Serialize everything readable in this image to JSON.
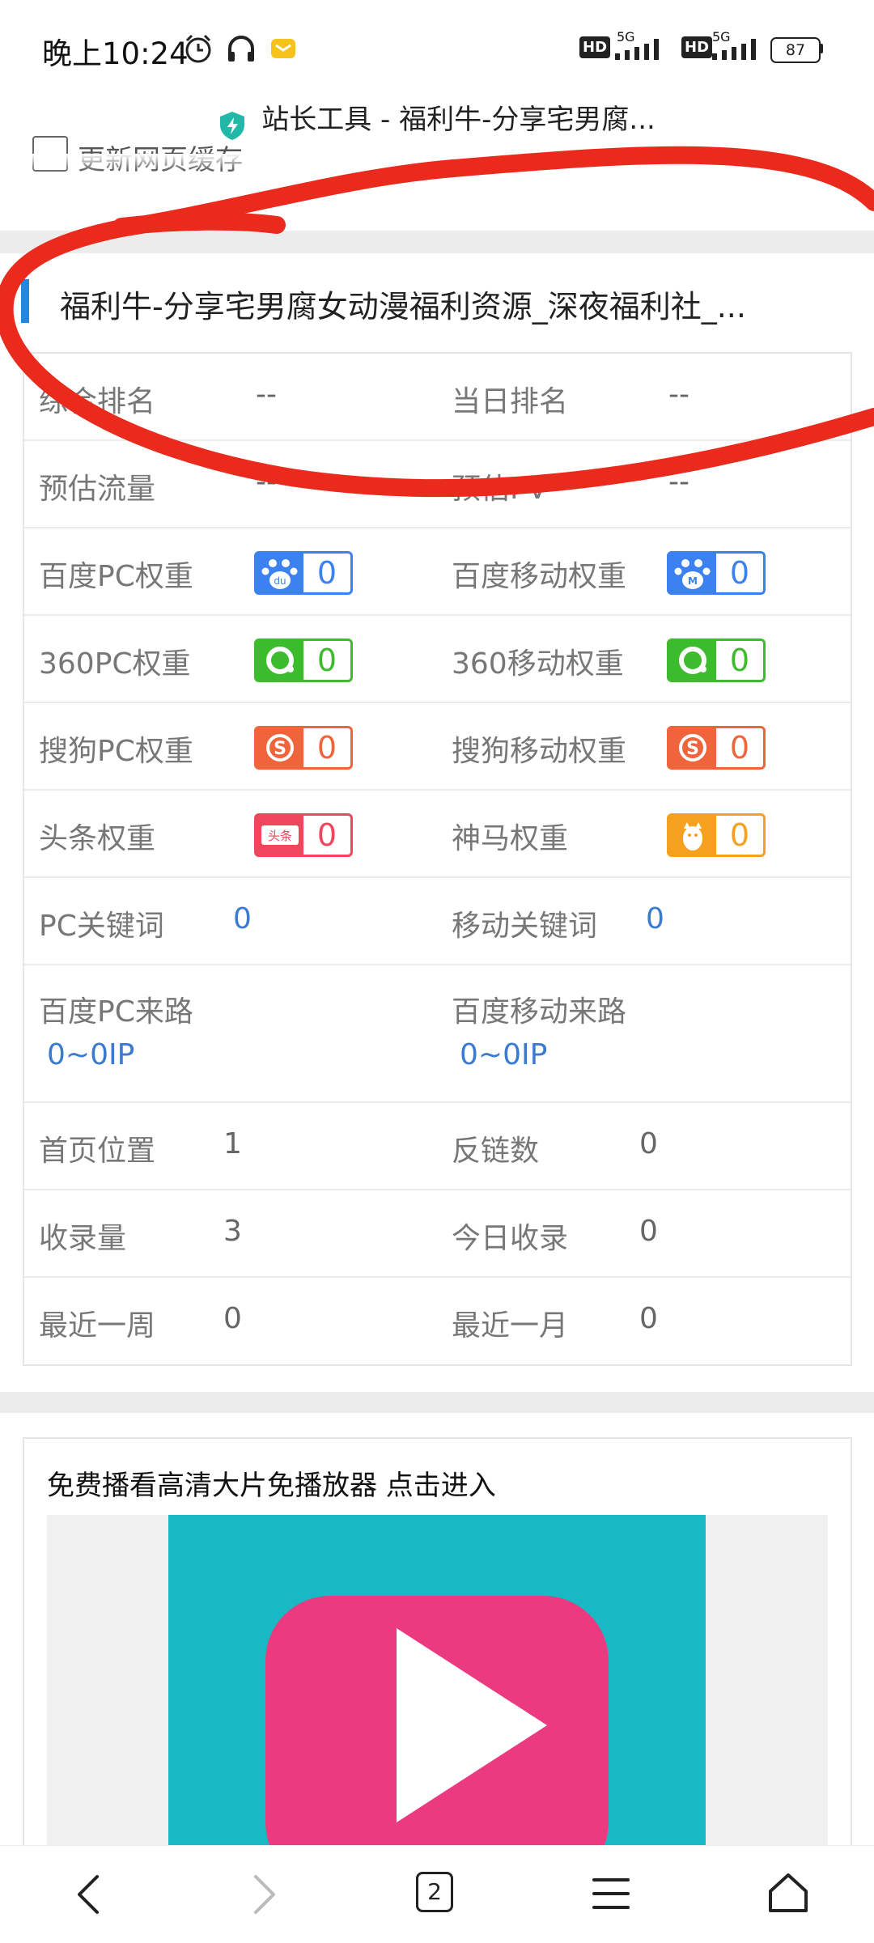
{
  "status_bar": {
    "time": "晚上10:24",
    "network1": "5G",
    "network2": "5G",
    "hd1": "HD",
    "hd2": "HD",
    "battery": "87"
  },
  "title_bar": {
    "text": "站长工具 - 福利牛-分享宅男腐..."
  },
  "refresh_cache_label": "更新网页缓存",
  "site_title": "福利牛-分享宅男腐女动漫福利资源_深夜福利社_...",
  "stats": {
    "rows": [
      {
        "l1": "综合排名",
        "v1": "--",
        "l2": "当日排名",
        "v2": "--"
      },
      {
        "l1": "预估流量",
        "v1": "--",
        "l2": "预估PV",
        "v2": "--"
      },
      {
        "l1": "百度PC权重",
        "v1": "0",
        "l2": "百度移动权重",
        "v2": "0"
      },
      {
        "l1": "360PC权重",
        "v1": "0",
        "l2": "360移动权重",
        "v2": "0"
      },
      {
        "l1": "搜狗PC权重",
        "v1": "0",
        "l2": "搜狗移动权重",
        "v2": "0"
      },
      {
        "l1": "头条权重",
        "v1": "0",
        "l2": "神马权重",
        "v2": "0"
      },
      {
        "l1": "PC关键词",
        "v1": "0",
        "l2": "移动关键词",
        "v2": "0"
      },
      {
        "l1": "百度PC来路",
        "v1": "0~0IP",
        "l2": "百度移动来路",
        "v2": "0~0IP"
      },
      {
        "l1": "首页位置",
        "v1": "1",
        "l2": "反链数",
        "v2": "0"
      },
      {
        "l1": "收录量",
        "v1": "3",
        "l2": "今日收录",
        "v2": "0"
      },
      {
        "l1": "最近一周",
        "v1": "0",
        "l2": "最近一月",
        "v2": "0"
      }
    ],
    "toutiao_badge_text": "头条",
    "baidu_pc_badge_text": "du",
    "baidu_m_badge_text": "M"
  },
  "ad": {
    "title": "免费播看高清大片免播放器 点击进入"
  },
  "bottom_nav": {
    "tab_count": "2"
  },
  "colors": {
    "baidu": "#3b82f0",
    "qihoo": "#3cbb2c",
    "sogou": "#f0643c",
    "toutiao": "#f0455c",
    "shenma": "#f6a020",
    "link_blue": "#3b7ad1",
    "ad_bg": "#18b8c4",
    "play_btn": "#ec3a80",
    "annotation_red": "#ea2a1c"
  }
}
